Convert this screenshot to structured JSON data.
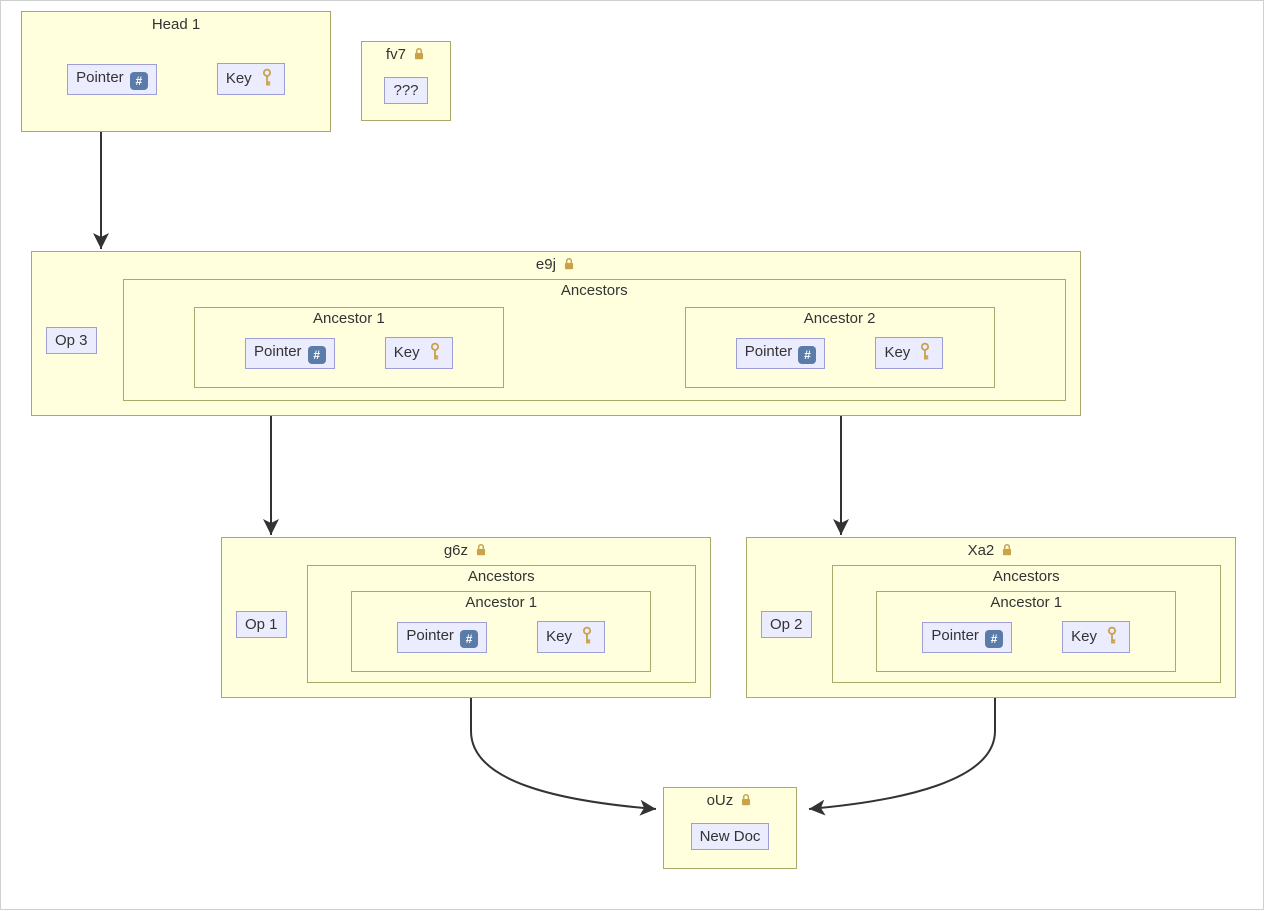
{
  "labels": {
    "pointer": "Pointer",
    "key": "Key",
    "ancestors": "Ancestors",
    "ancestor1": "Ancestor 1",
    "ancestor2": "Ancestor 2",
    "newdoc": "New Doc",
    "unknown": "???"
  },
  "nodes": {
    "head1": {
      "title": "Head 1"
    },
    "fv7": {
      "title": "fv7",
      "locked": true
    },
    "e9j": {
      "title": "e9j",
      "locked": true,
      "op": "Op 3"
    },
    "g6z": {
      "title": "g6z",
      "locked": true,
      "op": "Op 1"
    },
    "xa2": {
      "title": "Xa2",
      "locked": true,
      "op": "Op 2"
    },
    "oUz": {
      "title": "oUz",
      "locked": true
    }
  },
  "icons": {
    "hash_glyph": "#",
    "lock_color": "#c9a24a",
    "key_color": "#c9a24a"
  },
  "edges": [
    {
      "from": "head1-pointer",
      "to": "e9j-node"
    },
    {
      "from": "e9j-anc1-pointer",
      "to": "g6z-node"
    },
    {
      "from": "e9j-anc2-pointer",
      "to": "xa2-node"
    },
    {
      "from": "g6z-anc1-pointer",
      "to": "oUz-node"
    },
    {
      "from": "xa2-anc1-pointer",
      "to": "oUz-node"
    }
  ]
}
